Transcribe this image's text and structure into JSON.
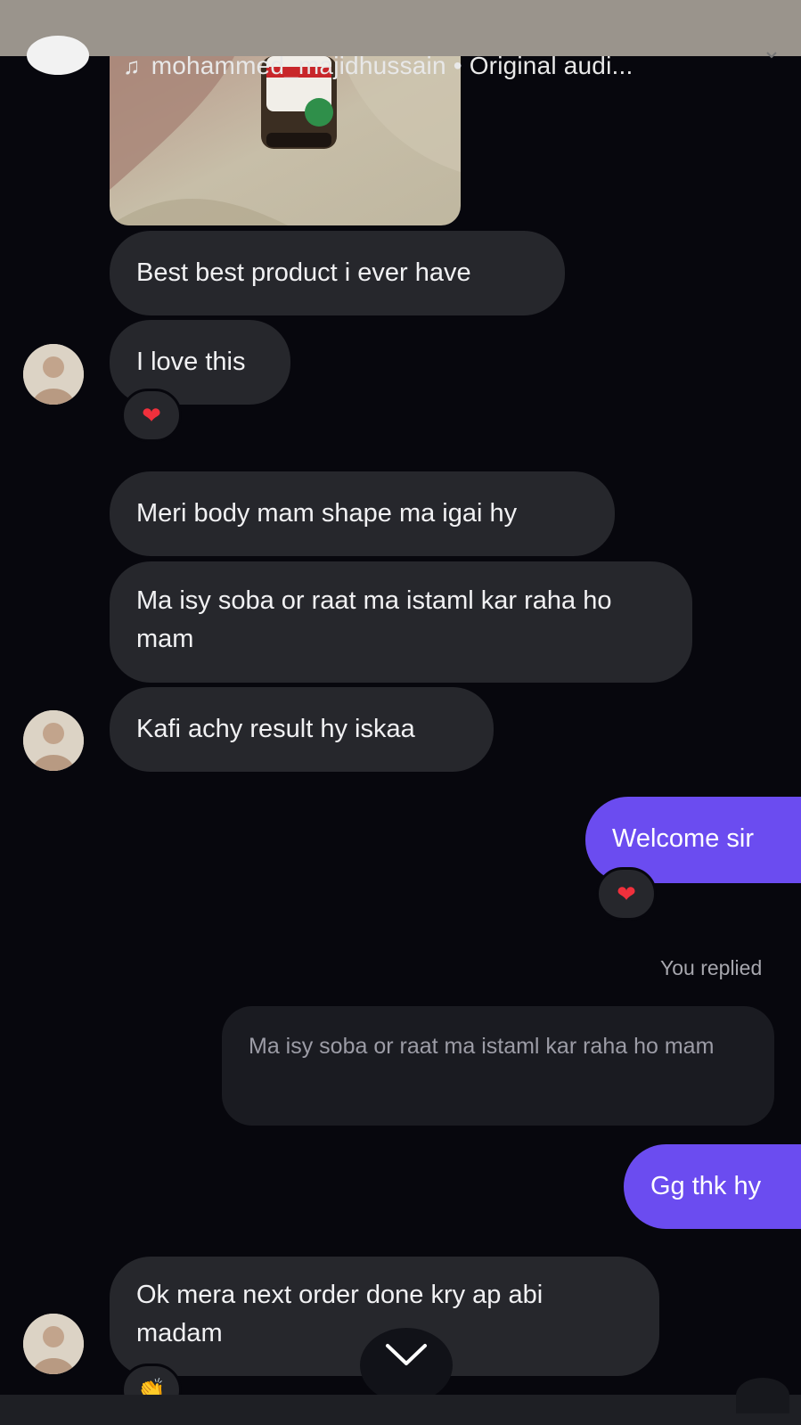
{
  "header": {
    "audio_label": "mohammed_majidhussain • Original audi..."
  },
  "messages": [
    {
      "id": "m1",
      "text": "Best best product i ever have"
    },
    {
      "id": "m2",
      "text": "I love this",
      "reaction": "❤"
    },
    {
      "id": "m3",
      "text": "Meri body mam shape ma igai hy"
    },
    {
      "id": "m4",
      "text": "Ma isy soba or raat ma istaml kar raha ho mam"
    },
    {
      "id": "m5",
      "text": "Kafi achy result hy iskaa"
    },
    {
      "id": "m6",
      "text": "Welcome sir",
      "reaction": "❤"
    },
    {
      "id": "m7",
      "status": "You replied",
      "quoted": "Ma isy soba or raat ma istaml kar raha ho mam"
    },
    {
      "id": "m8",
      "text": "Gg thk hy"
    },
    {
      "id": "m9",
      "text": "Ok mera next order done kry ap abi madam",
      "reaction": "👏"
    }
  ],
  "icons": {
    "music": "music-note-icon",
    "heart": "heart-icon",
    "scroll": "chevron-down-icon"
  },
  "colors": {
    "background": "#07070d",
    "incoming_bubble": "#26272c",
    "outgoing_bubble": "#6b4cf0",
    "quoted_bubble": "#1a1b21",
    "heart": "#f0303c"
  }
}
